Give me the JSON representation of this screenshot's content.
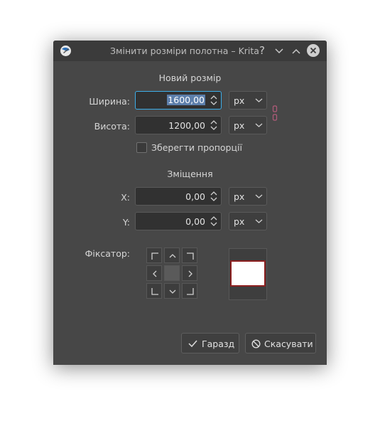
{
  "window": {
    "title": "Змінити розміри полотна – Krita",
    "help_glyph": "?",
    "minimize_glyph": "⌄",
    "maximize_glyph": "⌃"
  },
  "new_size": {
    "heading": "Новий розмір",
    "width": {
      "label": "Ширина:",
      "value": "1600,00",
      "unit": "px"
    },
    "height": {
      "label": "Висота:",
      "value": "1200,00",
      "unit": "px"
    },
    "keep_ratio": {
      "label": "Зберегти пропорції",
      "checked": false
    }
  },
  "offset": {
    "heading": "Зміщення",
    "x": {
      "label": "X:",
      "value": "0,00",
      "unit": "px"
    },
    "y": {
      "label": "Y:",
      "value": "0,00",
      "unit": "px"
    }
  },
  "anchor": {
    "label": "Фіксатор:",
    "selected": "center"
  },
  "buttons": {
    "ok": "Гаразд",
    "cancel": "Скасувати"
  },
  "colors": {
    "dialog_bg": "#474747",
    "titlebar_bg": "#3b3b3b",
    "focus_border": "#3daee9",
    "selection": "#5d7fab",
    "preview_border": "#8c2020"
  }
}
